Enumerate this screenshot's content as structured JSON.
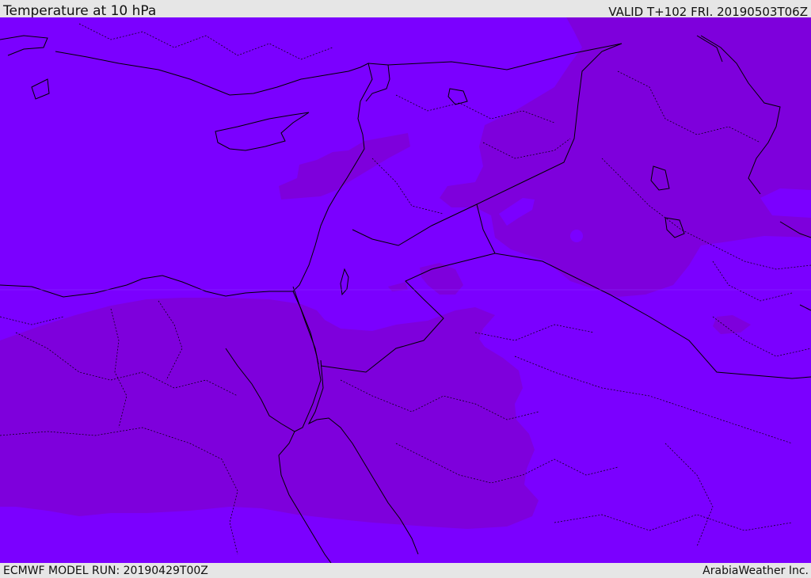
{
  "header": {
    "title": "Temperature at 10 hPa",
    "valid": "VALID T+102 FRI. 20190503T06Z"
  },
  "footer": {
    "model_run": "ECMWF MODEL RUN: 20190429T00Z",
    "credit": "ArabiaWeather Inc."
  },
  "colors": {
    "background_field": "#7b00ff",
    "warmer_field": "#7e00dc",
    "coastline": "#000000",
    "border": "#000000",
    "bars": "#e6e6e6"
  },
  "icons": {}
}
